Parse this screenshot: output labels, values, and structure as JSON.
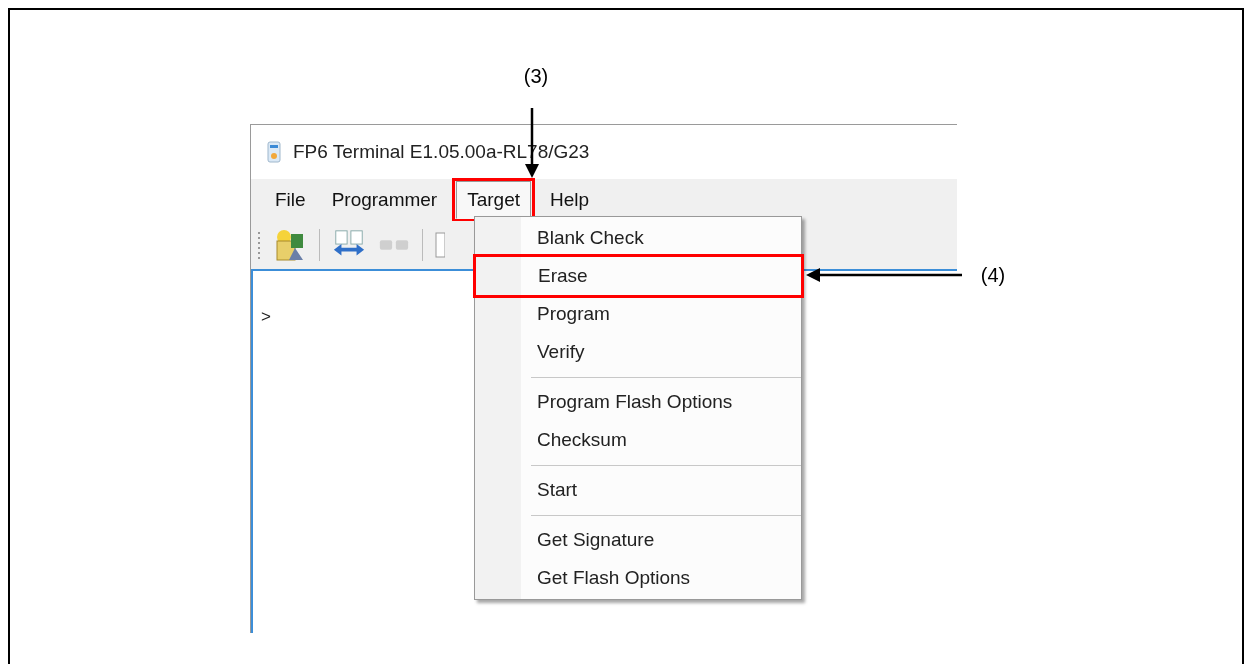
{
  "window": {
    "title": "FP6 Terminal E1.05.00a-RL78/G23"
  },
  "menu": [
    {
      "label": "File",
      "selected": false,
      "marked": false
    },
    {
      "label": "Programmer",
      "selected": false,
      "marked": false
    },
    {
      "label": "Target",
      "selected": true,
      "marked": true
    },
    {
      "label": "Help",
      "selected": false,
      "marked": false
    }
  ],
  "dropdown": {
    "groups": [
      [
        {
          "label": "Blank Check",
          "marked": false
        },
        {
          "label": "Erase",
          "marked": true
        },
        {
          "label": "Program",
          "marked": false
        },
        {
          "label": "Verify",
          "marked": false
        }
      ],
      [
        {
          "label": "Program Flash Options",
          "marked": false
        },
        {
          "label": "Checksum",
          "marked": false
        }
      ],
      [
        {
          "label": "Start",
          "marked": false
        }
      ],
      [
        {
          "label": "Get Signature",
          "marked": false
        },
        {
          "label": "Get Flash Options",
          "marked": false
        }
      ]
    ]
  },
  "console": {
    "prompt": ">"
  },
  "callouts": [
    {
      "label": "(3)",
      "kind": "down"
    },
    {
      "label": "(4)",
      "kind": "left"
    }
  ]
}
